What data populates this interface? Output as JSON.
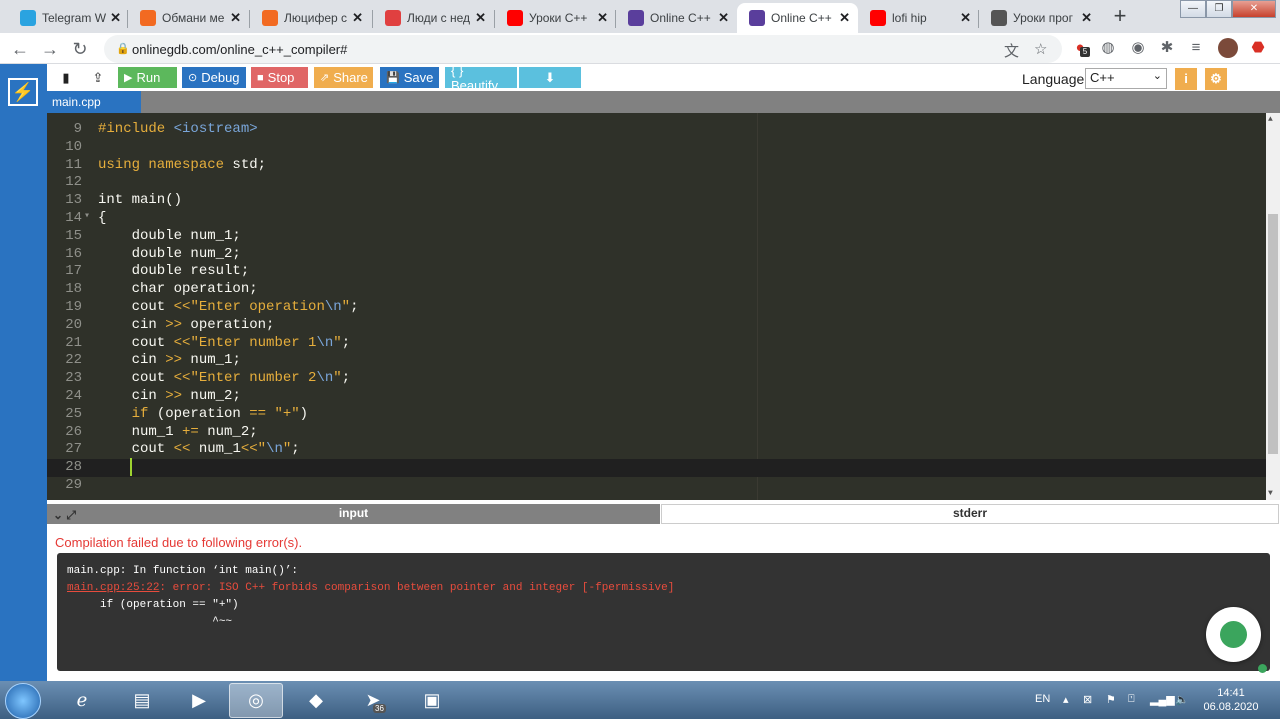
{
  "browser": {
    "tabs": [
      {
        "title": "Telegram W",
        "favicon": "telegram-icon",
        "color": "#2aa3e0"
      },
      {
        "title": "Обмани ме",
        "favicon": "f-icon",
        "color": "#f26a21"
      },
      {
        "title": "Люцифер с",
        "favicon": "f-icon",
        "color": "#f26a21"
      },
      {
        "title": "Люди с нед",
        "favicon": "flower-icon",
        "color": "#e04040"
      },
      {
        "title": "Уроки C++",
        "favicon": "youtube-icon",
        "color": "#ff0000"
      },
      {
        "title": "Online C++",
        "favicon": "onlinegdb-icon",
        "color": "#5a3e9c"
      },
      {
        "title": "Online C++",
        "favicon": "onlinegdb-icon",
        "color": "#5a3e9c",
        "active": true
      },
      {
        "title": "lofi hip",
        "favicon": "youtube-icon",
        "color": "#ff0000"
      },
      {
        "title": "Уроки прог",
        "favicon": "r-icon",
        "color": "#555555"
      }
    ],
    "new_tab_symbol": "+",
    "url": "onlinegdb.com/online_c++_compiler#",
    "extension_badge": "5"
  },
  "toolbar": {
    "run": "Run",
    "debug": "Debug",
    "stop": "Stop",
    "share": "Share",
    "save": "Save",
    "beautify": "{ } Beautify",
    "language_label": "Language",
    "language_value": "C++"
  },
  "file_tab": "main.cpp",
  "editor": {
    "lines": [
      {
        "n": "9",
        "parts": [
          {
            "t": "#include ",
            "c": "k-orange"
          },
          {
            "t": "<iostream>",
            "c": "k-blue"
          }
        ]
      },
      {
        "n": "10",
        "parts": []
      },
      {
        "n": "11",
        "parts": [
          {
            "t": "using namespace ",
            "c": "k-orange"
          },
          {
            "t": "std;",
            "c": ""
          }
        ]
      },
      {
        "n": "12",
        "parts": []
      },
      {
        "n": "13",
        "parts": [
          {
            "t": "int main()",
            "c": ""
          }
        ]
      },
      {
        "n": "14",
        "fold": true,
        "parts": [
          {
            "t": "{",
            "c": ""
          }
        ]
      },
      {
        "n": "15",
        "parts": [
          {
            "t": "    double num_1;",
            "c": ""
          }
        ]
      },
      {
        "n": "16",
        "parts": [
          {
            "t": "    double num_2;",
            "c": ""
          }
        ]
      },
      {
        "n": "17",
        "parts": [
          {
            "t": "    double result;",
            "c": ""
          }
        ]
      },
      {
        "n": "18",
        "parts": [
          {
            "t": "    char operation;",
            "c": ""
          }
        ]
      },
      {
        "n": "19",
        "parts": [
          {
            "t": "    cout ",
            "c": ""
          },
          {
            "t": "<<",
            "c": "k-orange"
          },
          {
            "t": "\"Enter operation",
            "c": "k-orange"
          },
          {
            "t": "\\n",
            "c": "k-blue"
          },
          {
            "t": "\"",
            "c": "k-orange"
          },
          {
            "t": ";",
            "c": ""
          }
        ]
      },
      {
        "n": "20",
        "parts": [
          {
            "t": "    cin ",
            "c": ""
          },
          {
            "t": ">>",
            "c": "k-orange"
          },
          {
            "t": " operation;",
            "c": ""
          }
        ]
      },
      {
        "n": "21",
        "parts": [
          {
            "t": "    cout ",
            "c": ""
          },
          {
            "t": "<<",
            "c": "k-orange"
          },
          {
            "t": "\"Enter number 1",
            "c": "k-orange"
          },
          {
            "t": "\\n",
            "c": "k-blue"
          },
          {
            "t": "\"",
            "c": "k-orange"
          },
          {
            "t": ";",
            "c": ""
          }
        ]
      },
      {
        "n": "22",
        "parts": [
          {
            "t": "    cin ",
            "c": ""
          },
          {
            "t": ">>",
            "c": "k-orange"
          },
          {
            "t": " num_1;",
            "c": ""
          }
        ]
      },
      {
        "n": "23",
        "parts": [
          {
            "t": "    cout ",
            "c": ""
          },
          {
            "t": "<<",
            "c": "k-orange"
          },
          {
            "t": "\"Enter number 2",
            "c": "k-orange"
          },
          {
            "t": "\\n",
            "c": "k-blue"
          },
          {
            "t": "\"",
            "c": "k-orange"
          },
          {
            "t": ";",
            "c": ""
          }
        ]
      },
      {
        "n": "24",
        "parts": [
          {
            "t": "    cin ",
            "c": ""
          },
          {
            "t": ">>",
            "c": "k-orange"
          },
          {
            "t": " num_2;",
            "c": ""
          }
        ]
      },
      {
        "n": "25",
        "parts": [
          {
            "t": "    if ",
            "c": "k-orange"
          },
          {
            "t": "(operation ",
            "c": ""
          },
          {
            "t": "==",
            "c": "k-orange"
          },
          {
            "t": " ",
            "c": ""
          },
          {
            "t": "\"+\"",
            "c": "k-orange"
          },
          {
            "t": ")",
            "c": ""
          }
        ]
      },
      {
        "n": "26",
        "parts": [
          {
            "t": "    num_1 ",
            "c": ""
          },
          {
            "t": "+=",
            "c": "k-orange"
          },
          {
            "t": " num_2;",
            "c": ""
          }
        ]
      },
      {
        "n": "27",
        "parts": [
          {
            "t": "    cout ",
            "c": ""
          },
          {
            "t": "<<",
            "c": "k-orange"
          },
          {
            "t": " num_1",
            "c": ""
          },
          {
            "t": "<<",
            "c": "k-orange"
          },
          {
            "t": "\"",
            "c": "k-orange"
          },
          {
            "t": "\\n",
            "c": "k-blue"
          },
          {
            "t": "\"",
            "c": "k-orange"
          },
          {
            "t": ";",
            "c": ""
          }
        ]
      },
      {
        "n": "28",
        "current": true,
        "parts": []
      },
      {
        "n": "29",
        "parts": []
      }
    ]
  },
  "io": {
    "input_tab": "input",
    "stderr_tab": "stderr",
    "fail_message": "Compilation failed due to following error(s).",
    "console_line1": "main.cpp: In function ‘int main()’:",
    "console_errloc": "main.cpp:25:22",
    "console_err": ": error: ISO C++ forbids comparison between pointer and integer [-fpermissive]",
    "console_line3": "     if (operation == \"+\")",
    "console_line4": "                      ^~~"
  },
  "taskbar": {
    "lang": "EN",
    "time": "14:41",
    "date": "06.08.2020",
    "telegram_badge": "36"
  },
  "colors": {
    "run": "#5cb85c",
    "debug": "#2a73c1",
    "stop": "#e06666",
    "share": "#f0ad4e",
    "save": "#2a73c1",
    "beautify": "#5bc0de",
    "download": "#5bc0de"
  }
}
